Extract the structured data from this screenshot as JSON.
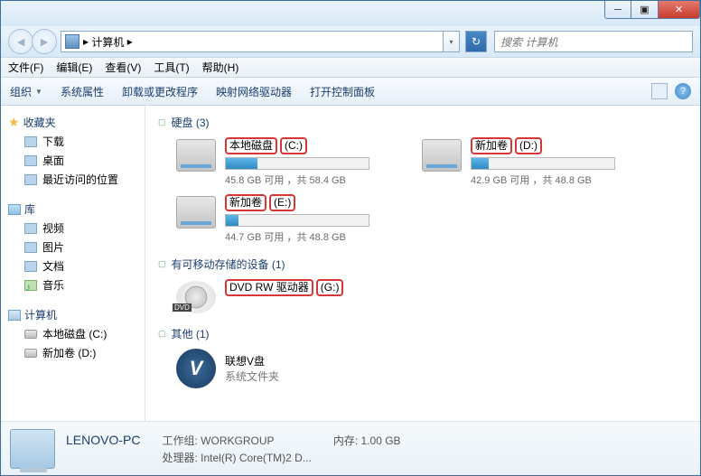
{
  "titlebar": {
    "min": "─",
    "max": "▣",
    "close": "✕"
  },
  "nav": {
    "back": "◄",
    "forward": "►",
    "location_icon": "🖥",
    "location": "计算机",
    "sep": "▸",
    "dropdown": "▾",
    "refresh": "↻"
  },
  "search": {
    "placeholder": "搜索 计算机"
  },
  "menu": {
    "file": "文件(F)",
    "edit": "编辑(E)",
    "view": "查看(V)",
    "tools": "工具(T)",
    "help": "帮助(H)"
  },
  "toolbar": {
    "organize": "组织",
    "props": "系统属性",
    "uninstall": "卸载或更改程序",
    "mapdrive": "映射网络驱动器",
    "controlpanel": "打开控制面板",
    "help": "?"
  },
  "sidebar": {
    "favorites": {
      "title": "收藏夹",
      "items": [
        "下载",
        "桌面",
        "最近访问的位置"
      ]
    },
    "libraries": {
      "title": "库",
      "items": [
        "视频",
        "图片",
        "文档",
        "音乐"
      ]
    },
    "computer": {
      "title": "计算机",
      "items": [
        "本地磁盘 (C:)",
        "新加卷 (D:)"
      ]
    }
  },
  "sections": {
    "hdd": {
      "title": "硬盘 (3)"
    },
    "removable": {
      "title": "有可移动存储的设备 (1)"
    },
    "other": {
      "title": "其他 (1)"
    }
  },
  "drives": {
    "c": {
      "name": "本地磁盘",
      "letter": "(C:)",
      "free": "45.8 GB 可用 ，共 58.4 GB",
      "pct": 22
    },
    "d": {
      "name": "新加卷",
      "letter": "(D:)",
      "free": "42.9 GB 可用 ，共 48.8 GB",
      "pct": 12
    },
    "e": {
      "name": "新加卷",
      "letter": "(E:)",
      "free": "44.7 GB 可用 ，共 48.8 GB",
      "pct": 9
    },
    "dvd": {
      "name": "DVD RW 驱动器",
      "letter": "(G:)",
      "badge": "DVD"
    }
  },
  "other_item": {
    "name": "联想V盘",
    "sub": "系统文件夹",
    "letter": "V"
  },
  "details": {
    "name": "LENOVO-PC",
    "workgroup_label": "工作组:",
    "workgroup": "WORKGROUP",
    "mem_label": "内存:",
    "mem": "1.00 GB",
    "cpu_label": "处理器:",
    "cpu": "Intel(R) Core(TM)2 D..."
  }
}
